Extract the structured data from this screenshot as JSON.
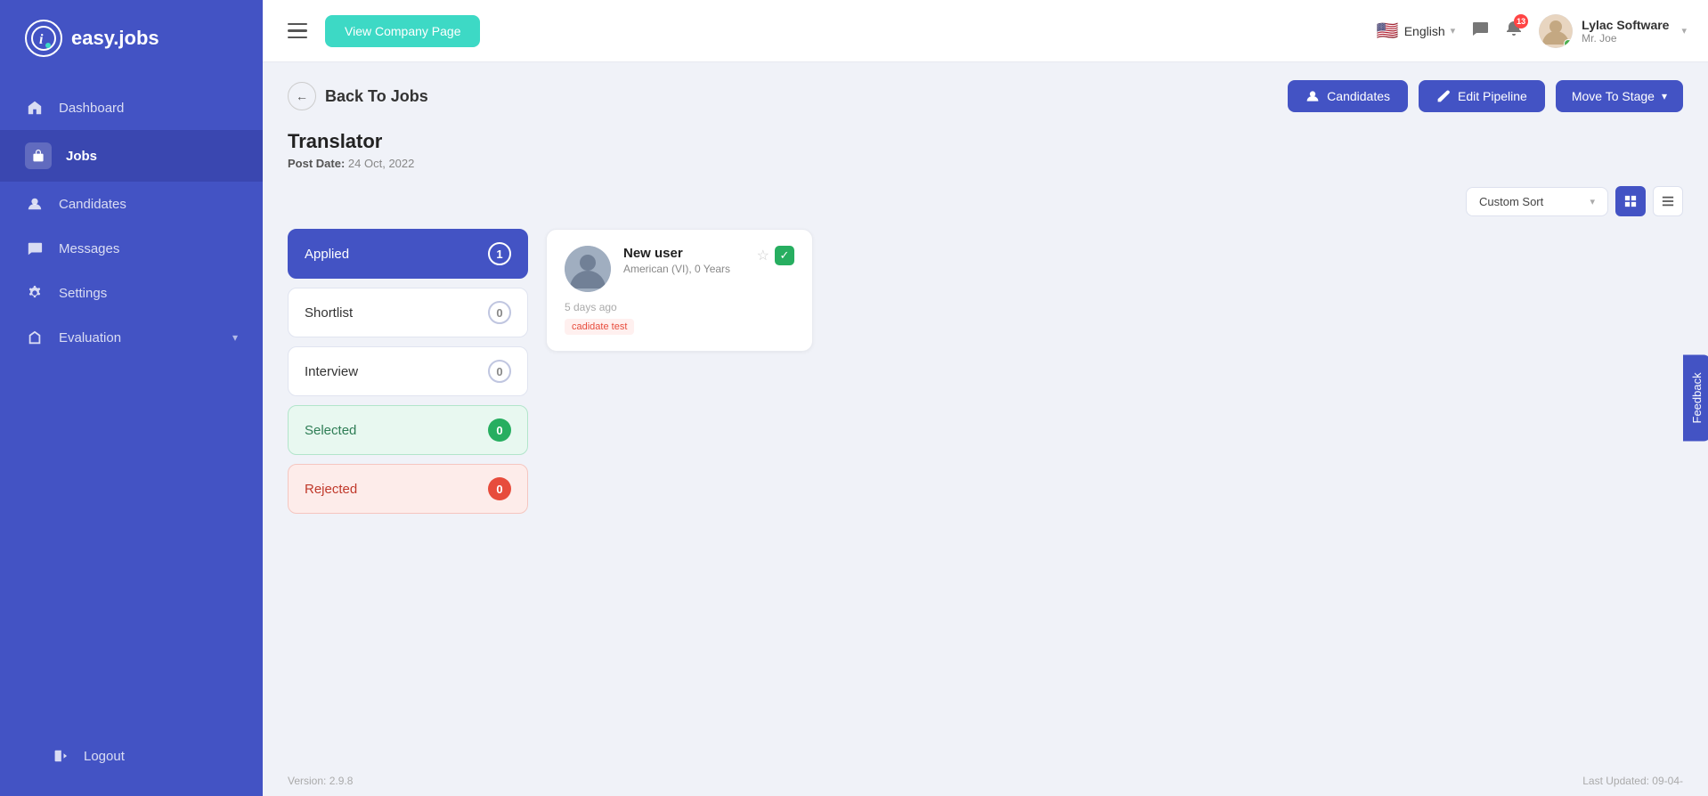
{
  "app": {
    "name": "easy.jobs",
    "logo_letter": "i"
  },
  "sidebar": {
    "items": [
      {
        "id": "dashboard",
        "label": "Dashboard",
        "icon": "🏠"
      },
      {
        "id": "jobs",
        "label": "Jobs",
        "icon": "💼",
        "active": true
      },
      {
        "id": "candidates",
        "label": "Candidates",
        "icon": "👤"
      },
      {
        "id": "messages",
        "label": "Messages",
        "icon": "💬"
      },
      {
        "id": "settings",
        "label": "Settings",
        "icon": "⚙️"
      },
      {
        "id": "evaluation",
        "label": "Evaluation",
        "icon": "🎓",
        "has_dropdown": true
      }
    ],
    "logout": "Logout"
  },
  "topbar": {
    "menu_icon": "☰",
    "view_company_btn": "View Company Page",
    "language": "English",
    "notif_count": "13",
    "company_name": "Lylac Software",
    "user_role": "Mr. Joe"
  },
  "page": {
    "back_label": "Back To Jobs",
    "job_title": "Translator",
    "post_date_label": "Post Date:",
    "post_date": "24 Oct, 2022",
    "buttons": {
      "candidates": "Candidates",
      "edit_pipeline": "Edit Pipeline",
      "move_to_stage": "Move To Stage"
    },
    "sort": {
      "label": "Custom Sort",
      "placeholder": "Custom Sort"
    },
    "stages": [
      {
        "id": "applied",
        "label": "Applied",
        "count": "1",
        "type": "active"
      },
      {
        "id": "shortlist",
        "label": "Shortlist",
        "count": "0",
        "type": "normal"
      },
      {
        "id": "interview",
        "label": "Interview",
        "count": "0",
        "type": "normal"
      },
      {
        "id": "selected",
        "label": "Selected",
        "count": "0",
        "type": "selected"
      },
      {
        "id": "rejected",
        "label": "Rejected",
        "count": "0",
        "type": "rejected"
      }
    ],
    "candidate": {
      "name": "New user",
      "location": "American (VI), 0 Years",
      "time_ago": "5 days ago",
      "tag": "cadidate test"
    },
    "footer": {
      "version": "Version: 2.9.8",
      "last_updated": "Last Updated: 09-04-"
    }
  }
}
